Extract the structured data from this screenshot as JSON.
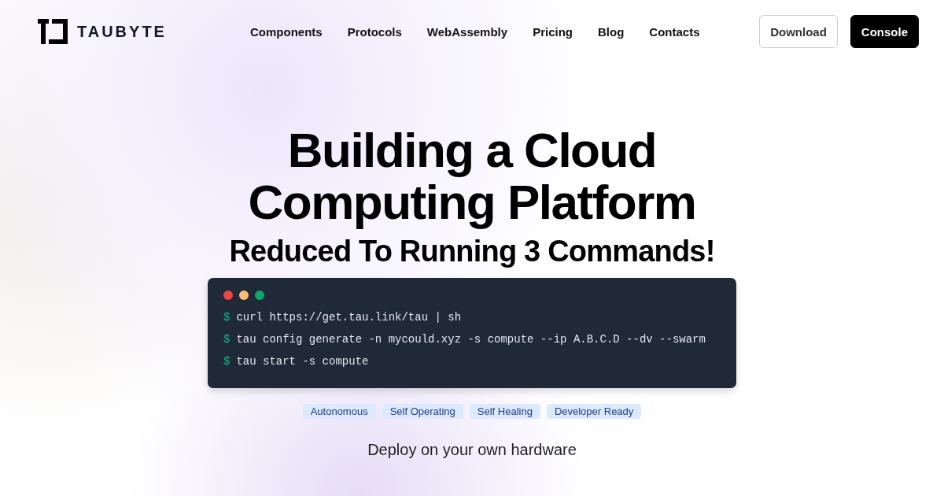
{
  "header": {
    "logo_text": "TAUBYTE",
    "nav": [
      "Components",
      "Protocols",
      "WebAssembly",
      "Pricing",
      "Blog",
      "Contacts"
    ],
    "buttons": [
      {
        "label": "Download",
        "kind": "outline"
      },
      {
        "label": "Console",
        "kind": "solid"
      }
    ]
  },
  "hero": {
    "title": "Building a Cloud Computing Platform",
    "subtitle": "Reduced To Running 3 Commands!"
  },
  "terminal": {
    "dots": [
      {
        "color": "#ef4444"
      },
      {
        "color": "#fdba74"
      },
      {
        "color": "#10a36b"
      }
    ],
    "commands": [
      {
        "prompt": "$",
        "text": "curl https://get.tau.link/tau | sh"
      },
      {
        "prompt": "$",
        "text": "tau config generate -n mycould.xyz -s compute --ip A.B.C.D --dv --swarm"
      },
      {
        "prompt": "$",
        "text": "tau start -s compute"
      }
    ]
  },
  "tags": [
    "Autonomous",
    "Self Operating",
    "Self Healing",
    "Developer Ready"
  ],
  "tagline": "Deploy on your own hardware"
}
